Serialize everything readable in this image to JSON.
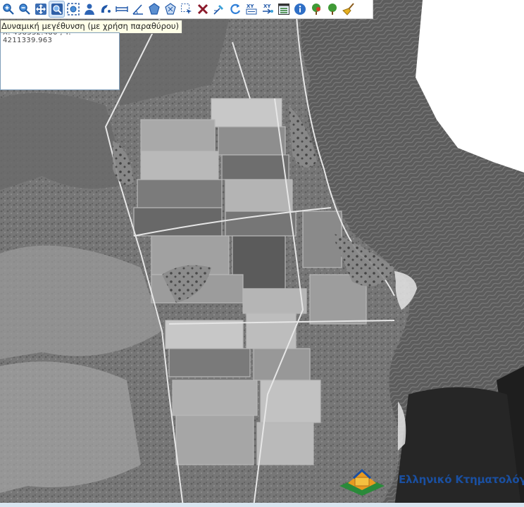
{
  "map": {
    "description_layer": "aerial-photo"
  },
  "toolbar": {
    "tools": [
      {
        "name": "zoom-in-icon"
      },
      {
        "name": "zoom-out-icon"
      },
      {
        "name": "pan-icon"
      },
      {
        "name": "zoom-box-icon"
      },
      {
        "name": "zoom-extent-icon"
      },
      {
        "name": "identify-person-icon"
      },
      {
        "name": "measure-icon"
      },
      {
        "name": "measure-line-icon"
      },
      {
        "name": "measure-angle-icon"
      },
      {
        "name": "polygon-icon"
      },
      {
        "name": "polygon-select-icon"
      },
      {
        "name": "select-box-icon"
      },
      {
        "name": "clear-icon"
      },
      {
        "name": "edit-vertex-icon"
      },
      {
        "name": "refresh-icon"
      },
      {
        "name": "xy-coordinates-icon"
      },
      {
        "name": "xy-goto-icon"
      },
      {
        "name": "layers-icon"
      },
      {
        "name": "info-icon"
      },
      {
        "name": "tree-red-icon"
      },
      {
        "name": "tree-green-icon"
      },
      {
        "name": "broom-icon"
      }
    ]
  },
  "tooltip": {
    "text": "Δυναμική μεγέθυνση (με χρήση παραθύρου)"
  },
  "coords": {
    "text": "X: 498332.480 , Y: 4211339.963"
  },
  "logo": {
    "text": "Ελληνικό Κτηματολόγιο"
  }
}
